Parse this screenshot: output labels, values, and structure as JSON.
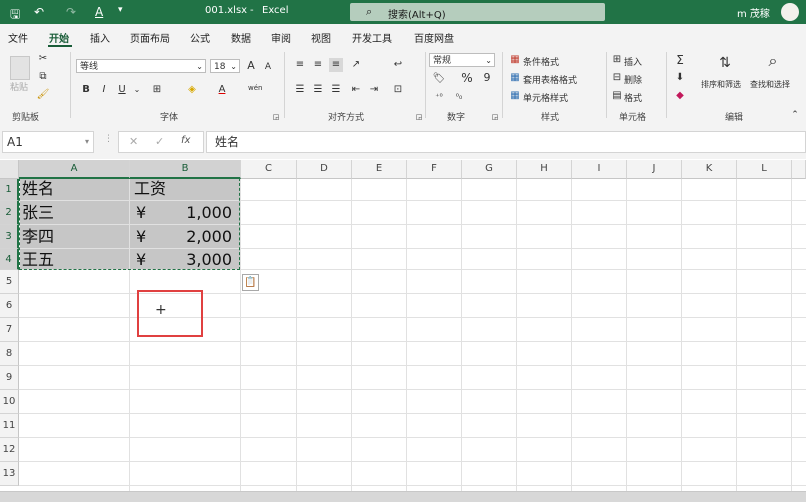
{
  "titlebar": {
    "filename": "001.xlsx",
    "separator": "-",
    "app": "Excel",
    "search_placeholder": "搜索(Alt+Q)",
    "user": "m 茂稼"
  },
  "tabs": [
    "文件",
    "开始",
    "插入",
    "页面布局",
    "公式",
    "数据",
    "审阅",
    "视图",
    "开发工具",
    "百度网盘"
  ],
  "active_tab": "开始",
  "ribbon": {
    "clipboard": {
      "paste": "粘贴",
      "label": "剪贴板"
    },
    "font": {
      "name": "等线",
      "size": "18",
      "label": "字体",
      "bold": "B",
      "italic": "I",
      "underline": "U",
      "grow": "A",
      "shrink": "A",
      "wen": "wén"
    },
    "align": {
      "label": "对齐方式"
    },
    "number": {
      "format": "常规",
      "percent": "%",
      "comma": "9",
      "label": "数字"
    },
    "styles": {
      "cond": "条件格式",
      "table": "套用表格格式",
      "cell": "单元格样式",
      "label": "样式"
    },
    "cells": {
      "insert": "插入",
      "delete": "删除",
      "format": "格式",
      "label": "单元格"
    },
    "editing": {
      "sum": "Σ",
      "sort": "排序和筛选",
      "find": "查找和选择",
      "label": "编辑"
    }
  },
  "formula_bar": {
    "name_box": "A1",
    "fx": "fx",
    "cancel": "✕",
    "enter": "✓",
    "content": "姓名"
  },
  "columns": [
    "A",
    "B",
    "C",
    "D",
    "E",
    "F",
    "G",
    "H",
    "I",
    "J",
    "K",
    "L"
  ],
  "rows": [
    "1",
    "2",
    "3",
    "4",
    "5",
    "6",
    "7",
    "8",
    "9",
    "10",
    "11",
    "12",
    "13"
  ],
  "cells": {
    "A1": "姓名",
    "B1": "工资",
    "A2": "张三",
    "A3": "李四",
    "A4": "王五",
    "currency": "¥",
    "B2": "1,000",
    "B3": "2,000",
    "B4": "3,000"
  },
  "cursor": "+",
  "colors": {
    "accent": "#217346",
    "selection": "#c6c6c6",
    "highlight_box": "#e04040"
  }
}
